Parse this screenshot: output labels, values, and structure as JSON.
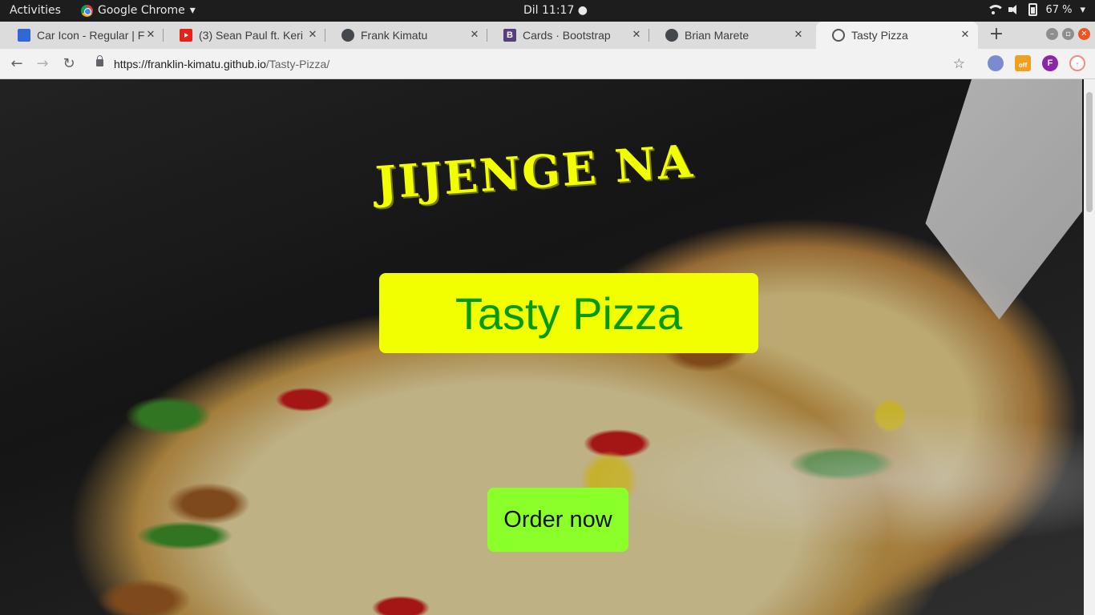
{
  "topbar": {
    "activities": "Activities",
    "app_name": "Google Chrome",
    "app_menu_arrow": "▾",
    "clock": "Dil 11:17 ●",
    "battery": "67 %"
  },
  "tabs": [
    {
      "title": "Car Icon - Regular | F",
      "favicon": "flag-icon"
    },
    {
      "title": "(3) Sean Paul ft. Keri",
      "favicon": "youtube-icon"
    },
    {
      "title": "Frank Kimatu",
      "favicon": "github-icon"
    },
    {
      "title": "Cards · Bootstrap",
      "favicon": "bootstrap-icon",
      "favicon_text": "B"
    },
    {
      "title": "Brian Marete",
      "favicon": "github-icon"
    },
    {
      "title": "Tasty Pizza",
      "favicon": "globe-icon",
      "active": true
    }
  ],
  "toolbar": {
    "url_host": "https://franklin-kimatu.github.io",
    "url_path": "/Tasty-Pizza/",
    "extension_f": "F",
    "extension_off": "off"
  },
  "page": {
    "slogan": "JIJENGE NA",
    "title": "Tasty Pizza",
    "order_button": "Order now"
  },
  "colors": {
    "title_bg": "#f2ff00",
    "title_text": "#079a07",
    "order_bg": "#8aff2a",
    "slogan": "#f2ff00"
  }
}
